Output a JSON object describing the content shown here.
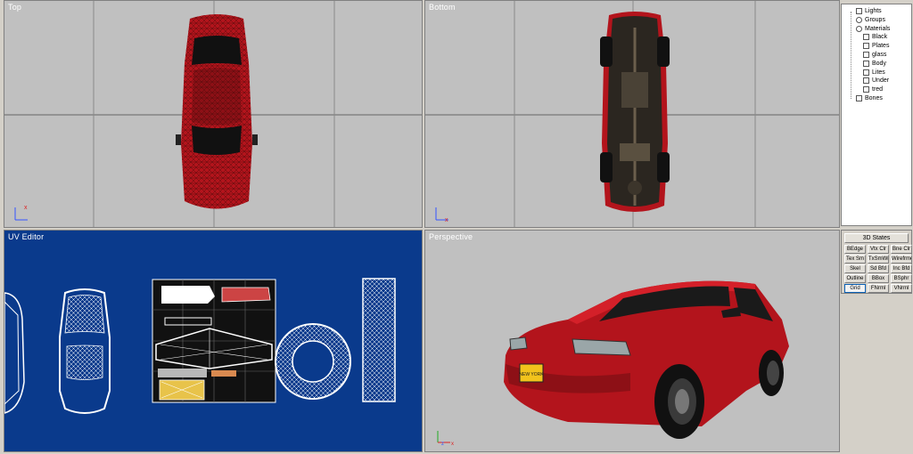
{
  "viewports": {
    "top": {
      "title": "Top"
    },
    "bottom": {
      "title": "Bottom"
    },
    "uv": {
      "title": "UV Editor"
    },
    "perspective": {
      "title": "Perspective"
    }
  },
  "tree": [
    {
      "label": "Lights",
      "icon": "light-icon"
    },
    {
      "label": "Groups",
      "icon": "groups-icon"
    },
    {
      "label": "Materials",
      "icon": "materials-icon"
    },
    {
      "label": "Black",
      "icon": "material-icon"
    },
    {
      "label": "Plates",
      "icon": "material-icon"
    },
    {
      "label": "glass",
      "icon": "material-icon"
    },
    {
      "label": "Body",
      "icon": "material-icon"
    },
    {
      "label": "Lites",
      "icon": "material-icon"
    },
    {
      "label": "Under",
      "icon": "material-icon"
    },
    {
      "label": "tred",
      "icon": "material-icon"
    },
    {
      "label": "Bones",
      "icon": "bones-icon"
    }
  ],
  "states": {
    "header": "3D States",
    "buttons": [
      {
        "label": "BEdge"
      },
      {
        "label": "Vtx Clr"
      },
      {
        "label": "Bne Clr"
      },
      {
        "label": "Tex Sm"
      },
      {
        "label": "TxSmWr"
      },
      {
        "label": "Wirefrme"
      },
      {
        "label": "Skel"
      },
      {
        "label": "Sd Bfd"
      },
      {
        "label": "Inc Bfd"
      },
      {
        "label": "Outline"
      },
      {
        "label": "BBox"
      },
      {
        "label": "BSphr"
      },
      {
        "label": "Grid",
        "active": true
      },
      {
        "label": "FNrml"
      },
      {
        "label": "VNrml"
      }
    ]
  },
  "plate_text": "NEW YORK",
  "colors": {
    "car_red": "#b3141c",
    "uv_bg": "#0a3a8c",
    "viewport_bg": "#c0c0c0",
    "active_border": "#0a5fb3"
  }
}
